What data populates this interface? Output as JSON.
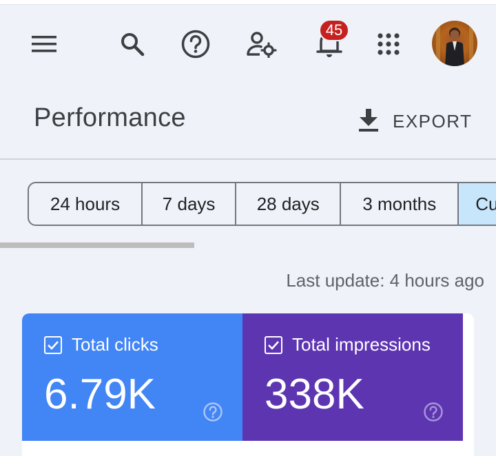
{
  "toolbar": {
    "icons": [
      "menu-icon",
      "search-icon",
      "help-icon",
      "admin-settings-icon",
      "notifications-icon",
      "apps-icon"
    ],
    "notification_count": "45"
  },
  "header": {
    "title": "Performance",
    "export_label": "EXPORT"
  },
  "date_range": {
    "tabs": [
      {
        "label": "24 hours",
        "selected": false
      },
      {
        "label": "7 days",
        "selected": false
      },
      {
        "label": "28 days",
        "selected": false
      },
      {
        "label": "3 months",
        "selected": false
      },
      {
        "label": "Cu",
        "selected": true
      }
    ]
  },
  "last_update": "Last update: 4 hours ago",
  "metrics": {
    "clicks": {
      "label": "Total clicks",
      "value": "6.79K",
      "checked": true,
      "color": "#4285f4"
    },
    "impressions": {
      "label": "Total impressions",
      "value": "338K",
      "checked": true,
      "color": "#5e35b1"
    }
  }
}
